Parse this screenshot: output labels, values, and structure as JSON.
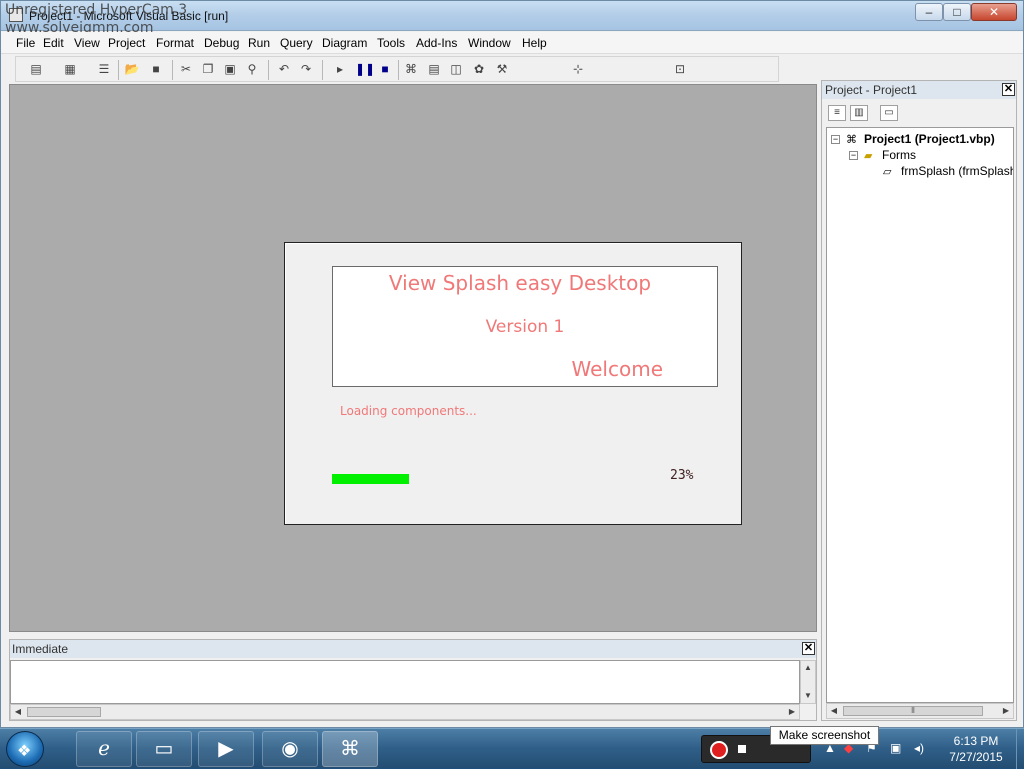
{
  "window": {
    "title": "Project1 - Microsoft Visual Basic [run]",
    "watermark_line1": "Unregistered HyperCam 3",
    "watermark_line2": "www.solveigmm.com",
    "controls": {
      "minimize": "–",
      "maximize": "□",
      "close": "✕"
    }
  },
  "menubar": {
    "items": [
      "File",
      "Edit",
      "View",
      "Project",
      "Format",
      "Debug",
      "Run",
      "Query",
      "Diagram",
      "Tools",
      "Add-Ins",
      "Window",
      "Help"
    ]
  },
  "toolbar": {
    "icons": [
      "add-project-icon",
      "add-form-icon",
      "menu-editor-icon",
      "open-icon",
      "save-icon",
      "cut-icon",
      "copy-icon",
      "paste-icon",
      "find-icon",
      "undo-icon",
      "redo-icon",
      "start-icon",
      "break-icon",
      "end-icon",
      "project-explorer-icon",
      "properties-icon",
      "form-layout-icon",
      "object-browser-icon",
      "toolbox-icon",
      "position-icon",
      "size-icon"
    ]
  },
  "splash": {
    "title": "View Splash easy Desktop",
    "version": "Version 1",
    "welcome": "Welcome",
    "loading": "Loading components...",
    "progress_value": 0.23,
    "progress_label": "23%",
    "progress_color": "#00f000",
    "text_color": "#f07878"
  },
  "project_panel": {
    "title": "Project - Project1",
    "close": "✕",
    "tree": {
      "project": "Project1 (Project1.vbp)",
      "folder": "Forms",
      "form": "frmSplash (frmSplash.frm)"
    }
  },
  "immediate": {
    "title": "Immediate",
    "close": "✕"
  },
  "taskbar": {
    "tooltip": "Make screenshot",
    "time": "6:13 PM",
    "date": "7/27/2015",
    "tasks": [
      "internet-explorer-icon",
      "file-explorer-icon",
      "media-player-icon",
      "firefox-icon",
      "visual-basic-icon"
    ]
  }
}
